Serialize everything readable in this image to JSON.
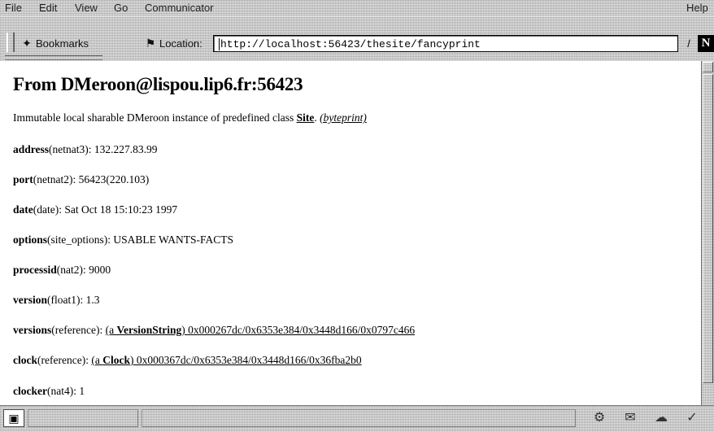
{
  "menubar": {
    "file": "File",
    "edit": "Edit",
    "view": "View",
    "go": "Go",
    "communicator": "Communicator",
    "help": "Help"
  },
  "toolbar": {
    "bookmarks_label": "Bookmarks",
    "location_label": "Location:",
    "url": "http://localhost:56423/thesite/fancyprint",
    "bookmarks_icon": "bookmark-icon",
    "location_icon": "location-icon"
  },
  "content": {
    "title": "From DMeroon@lispou.lip6.fr:56423",
    "intro_text": "Immutable local sharable DMeroon instance of predefined class ",
    "intro_class_link": "Site",
    "intro_dot": ". ",
    "intro_byteprint": "(byteprint)",
    "fields": [
      {
        "name": "address",
        "type": "(netnat3)",
        "sep": ": ",
        "value": "132.227.83.99"
      },
      {
        "name": "port",
        "type": "(netnat2)",
        "sep": ": ",
        "value": "56423(220.103)"
      },
      {
        "name": "date",
        "type": "(date)",
        "sep": ": ",
        "value": "Sat Oct 18 15:10:23 1997"
      },
      {
        "name": "options",
        "type": "(site_options)",
        "sep": ": ",
        "value": "USABLE WANTS-FACTS"
      },
      {
        "name": "processid",
        "type": "(nat2)",
        "sep": ": ",
        "value": "9000"
      },
      {
        "name": "version",
        "type": "(float1)",
        "sep": ": ",
        "value": "1.3"
      },
      {
        "name": "versions",
        "type": "(reference)",
        "sep": ": ",
        "link_pre": "(a ",
        "link_class": "VersionString",
        "link_post": ") 0x000267dc/0x6353e384/0x3448d166/0x0797c466"
      },
      {
        "name": "clock",
        "type": "(reference)",
        "sep": ": ",
        "link_pre": "(a ",
        "link_class": "Clock",
        "link_post": ") 0x000367dc/0x6353e384/0x3448d166/0x36fba2b0"
      },
      {
        "name": "clocker",
        "type": "(nat4)",
        "sep": ": ",
        "value": "1"
      }
    ]
  },
  "statusbar": {
    "security_icon": "security-lock-icon",
    "component_icons": [
      "navigator-icon",
      "mail-icon",
      "discussion-icon",
      "composer-icon"
    ]
  }
}
